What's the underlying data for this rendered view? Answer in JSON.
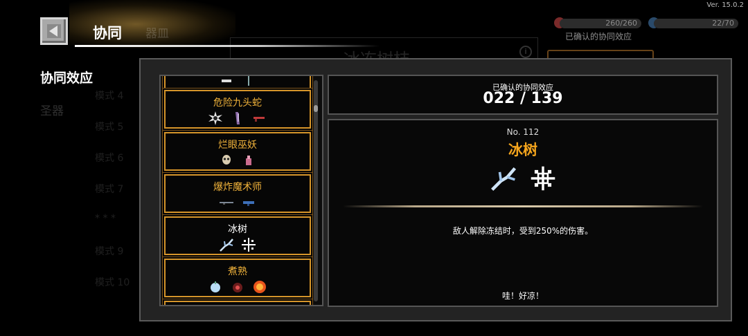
{
  "version": "Ver. 15.0.2",
  "header": {
    "title": "协同",
    "ghost_tab": "器皿"
  },
  "sidebar": {
    "active": "协同效应",
    "item": "圣器",
    "ghost_list": [
      "模式 4",
      "模式 5",
      "模式 6",
      "模式 7",
      "* * *",
      "模式 9",
      "模式 10"
    ]
  },
  "background": {
    "ghost_title": "冰冻树枝",
    "stat_1": "260/260",
    "stat_2": "22/70",
    "confirmed_label": "已确认的协同效应"
  },
  "synergy_list": [
    {
      "name": "危险九头蛇",
      "highlight": false,
      "icons": [
        "skull-burst-icon",
        "claw-icon",
        "gun-icon"
      ]
    },
    {
      "name": "烂眼巫妖",
      "highlight": false,
      "icons": [
        "skull-icon",
        "bottle-icon"
      ]
    },
    {
      "name": "爆炸魔术师",
      "highlight": false,
      "icons": [
        "rifle-icon",
        "blaster-icon"
      ]
    },
    {
      "name": "冰树",
      "highlight": true,
      "icons": [
        "ice-branch-icon",
        "snowflake-icon"
      ]
    },
    {
      "name": "煮熟",
      "highlight": false,
      "icons": [
        "apple-icon",
        "potion-icon",
        "fireball-icon"
      ]
    }
  ],
  "counter": {
    "label": "已确认的协同效应",
    "value": "022 / 139"
  },
  "detail": {
    "number": "No. 112",
    "name": "冰树",
    "description": "敌人解除冻结时，受到250%的伤害。",
    "quote": "哇！好凉！"
  },
  "colors": {
    "accent_gold": "#f4a41c",
    "card_border": "#d6952a",
    "panel_bg": "#232323"
  }
}
